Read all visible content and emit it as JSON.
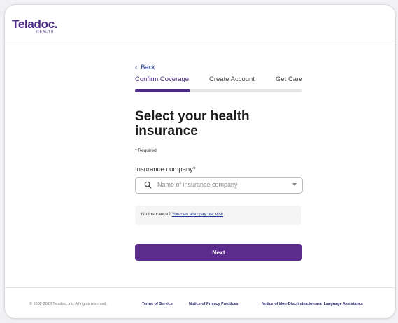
{
  "header": {
    "logo_text": "Teladoc",
    "logo_sub": "HEALTH",
    "brand_color": "#4b2b84"
  },
  "nav": {
    "back_label": "Back"
  },
  "steps": {
    "items": [
      {
        "label": "Confirm Coverage",
        "active": true
      },
      {
        "label": "Create Account",
        "active": false
      },
      {
        "label": "Get Care",
        "active": false
      }
    ],
    "progress_fraction": 0.33
  },
  "main": {
    "title": "Select your health insurance",
    "required_note": "* Required",
    "insurance_label": "Insurance company*",
    "insurance_placeholder": "Name of insurance company",
    "notice_prefix": "No insurance?",
    "notice_link": "You can also pay per visit",
    "notice_suffix": ".",
    "next_label": "Next",
    "button_color": "#5b2c8e"
  },
  "footer": {
    "copyright": "© 2002-2023 Teladoc, Inc. All rights reserved.",
    "links": [
      "Terms of Service",
      "Notice of Privacy Practices",
      "Notice of Non-Discrimination and Language Assistance"
    ]
  }
}
